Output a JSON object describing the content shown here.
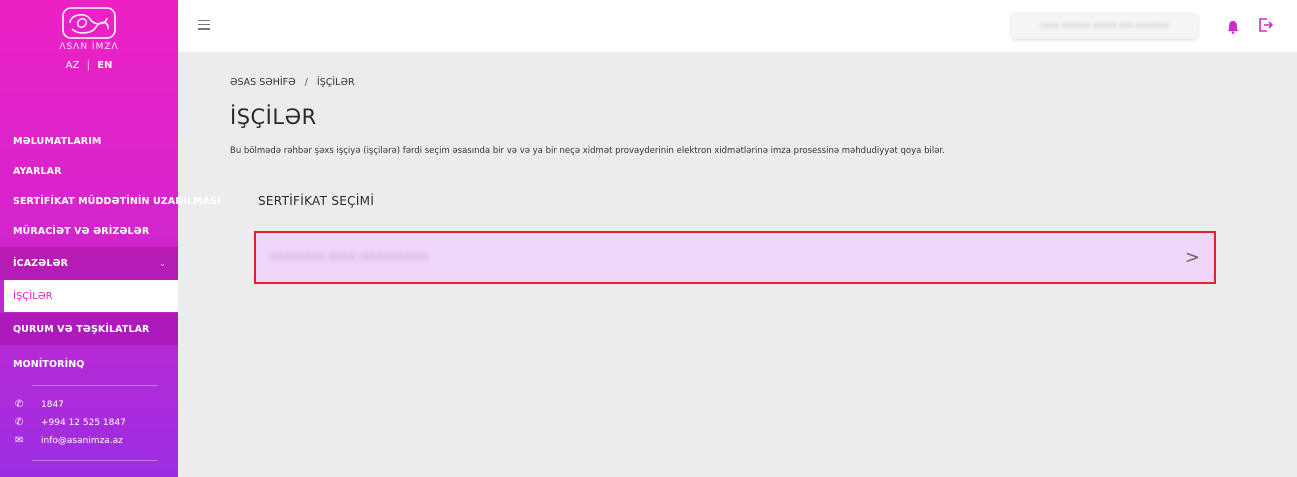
{
  "sidebar": {
    "logo_text": "ΛSΛN İMZΛ",
    "lang": {
      "az": "AZ",
      "sep": "|",
      "en": "EN"
    },
    "items": [
      {
        "label": "MƏLUMATLARIM"
      },
      {
        "label": "AYARLAR"
      },
      {
        "label": "SERTİFİKAT MÜDDƏTİNİN UZADILMASI"
      },
      {
        "label": "MÜRACİƏT VƏ ƏRİZƏLƏR"
      },
      {
        "label": "İCAZƏLƏR",
        "chevron": "⌄"
      },
      {
        "label": "QURUM VƏ TƏŞKİLATLAR"
      },
      {
        "label": "MONİTORİNQ"
      }
    ],
    "subitem": {
      "label": "İŞÇİLƏR"
    },
    "contacts": [
      {
        "icon": "phone-icon",
        "text": "1847"
      },
      {
        "icon": "phone-icon",
        "text": "+994 12 525 1847"
      },
      {
        "icon": "mail-icon",
        "text": "info@asanimza.az"
      }
    ]
  },
  "topbar": {
    "user_name": "XXXX XXXXXX XXXXX XXX XXXXXXX",
    "icons": [
      "menu-icon",
      "bell-icon",
      "logout-icon"
    ]
  },
  "breadcrumb": {
    "home": "ƏSAS SƏHİFƏ",
    "sep": "/",
    "current": "İŞÇİLƏR"
  },
  "page": {
    "title": "İŞÇİLƏR",
    "description": "Bu bölmədə rəhbər şəxs işçiyə (işçilərə) fərdi seçim əsasında bir və və ya bir neçə xidmət provayderinin elektron xidmətlərinə imza prosessinə məhdudiyyət qoya bilər.",
    "section_title": "SERTİFİKAT SEÇİMİ",
    "certificate": {
      "label": "XXXXXXXX XXXX (XXXXXXXXX)",
      "arrow": ">"
    }
  },
  "colors": {
    "sidebar_top": "#ec21c4",
    "sidebar_bottom": "#9b2ee3",
    "selected_row_bg": "#f0d6f8",
    "highlight_border": "#e32227",
    "bell": "#d32acb"
  }
}
